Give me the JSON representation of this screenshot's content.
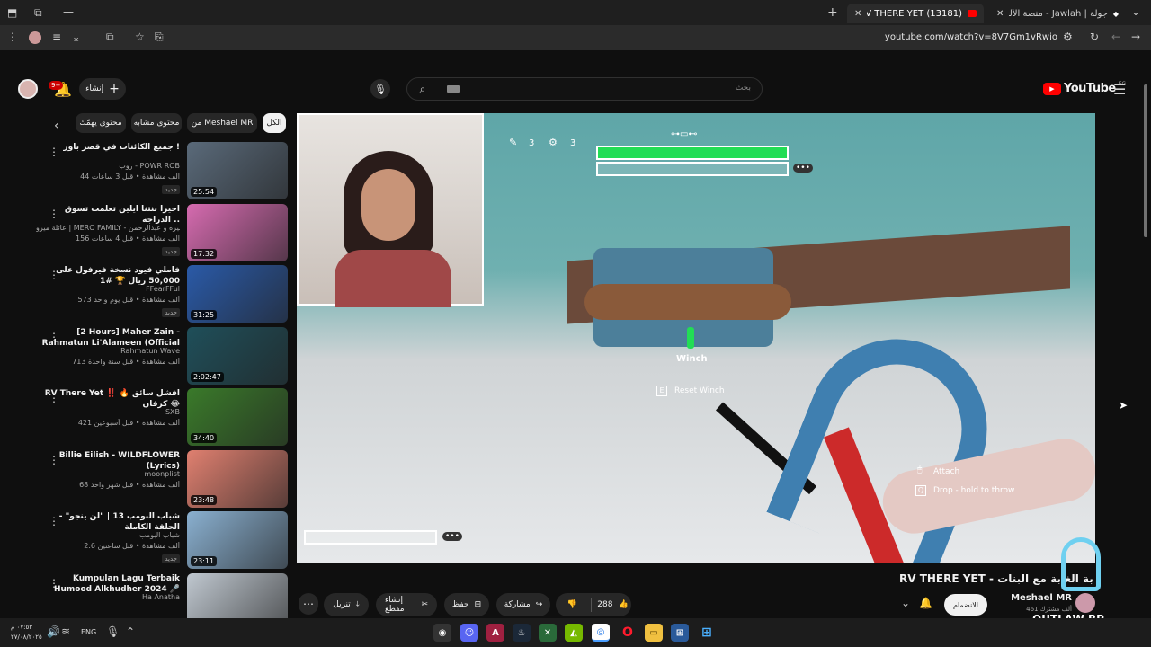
{
  "browser": {
    "tabs": [
      {
        "title": "جولة | Jawlah - منصة الألعاب الـ",
        "active": false
      },
      {
        "title": "(13181) RV THERE YET - البنـات",
        "active": true
      }
    ],
    "new_tab": "+",
    "url": "youtube.com/watch?v=8V7Gm1vRwio"
  },
  "youtube": {
    "logo": "YouTube",
    "country": "EG",
    "search_placeholder": "بحث",
    "create_label": "إنشاء",
    "notif_count": "9+",
    "chips": [
      "الكل",
      "من Meshael MR",
      "محتوى مشابه",
      "محتوى يهمّك"
    ],
    "recommendations": [
      {
        "title": "جميع الكائنات في قصر باور !",
        "channel": "روب - POWR ROB",
        "meta": "44 ألف مشاهدة • قبل 3 ساعات",
        "duration": "25:54",
        "badge": "جديد",
        "thumb": "#5a6a7a"
      },
      {
        "title": "اخيرا بنتنا ايلين تعلمت تسوق الدراجه ..",
        "channel": "عائلة ميرو | MERO FAMILY - اميره و عبدالرحمن",
        "meta": "156 ألف مشاهدة • قبل 4 ساعات",
        "duration": "17:32",
        "badge": "جديد",
        "thumb": "#d66bb0"
      },
      {
        "title": "فاملي فيود نسخة فيرفول على 50,000 ريال 🏆 #1",
        "channel": "FFearFFul",
        "meta": "573 ألف مشاهدة • قبل يوم واحد",
        "duration": "31:25",
        "badge": "جديد",
        "thumb": "#2a5aa8"
      },
      {
        "title": "[2 Hours] Maher Zain - Rahmatun Li'Alameen (Official",
        "channel": "Rahmatun Wave",
        "meta": "713 ألف مشاهدة • قبل سنة واحدة",
        "duration": "2:02:47",
        "badge": "",
        "thumb": "#1f4f5a"
      },
      {
        "title": "RV There Yet ‼️ 🔥 افشل سائق كرفان 😂",
        "channel": "SXB",
        "meta": "421 ألف مشاهدة • قبل أسبوعين",
        "duration": "34:40",
        "badge": "",
        "thumb": "#3a7a2a"
      },
      {
        "title": "Billie Eilish - WILDFLOWER (Lyrics)",
        "channel": "moonplist",
        "meta": "68 ألف مشاهدة • قبل شهر واحد",
        "duration": "23:48",
        "badge": "",
        "thumb": "#e08070"
      },
      {
        "title": "شباب البومب 13 | \"لن ينجو\" - الحلقة الكاملة",
        "channel": "شباب البومب",
        "meta": "2.6 ألف مشاهدة • قبل ساعتين",
        "duration": "23:11",
        "badge": "جديد",
        "thumb": "#8ab0d0"
      },
      {
        "title": "Kumpulan Lagu Terbaik Humood Alkhudher 2024 🎤",
        "channel": "Ha Anatha",
        "meta": "",
        "duration": "",
        "badge": "",
        "thumb": "#c0c8d0"
      }
    ],
    "video": {
      "title": "RV THERE YET - تجربة الغابة مع البنات",
      "channel": "Meshael MR",
      "subscribers": "461 ألف مشترك",
      "join_label": "الانضمام",
      "likes": "288",
      "share_label": "مشاركة",
      "save_label": "حفظ",
      "clip_label": "إنشاء مقطع",
      "download_label": "تنزيل",
      "hud": {
        "pencil_count": "3",
        "tool_count": "3",
        "winch_label": "Winch",
        "reset_label": "Reset Winch",
        "reset_key": "E",
        "attach_label": "Attach",
        "drop_label": "Drop - hold to throw",
        "drop_key": "Q"
      }
    }
  },
  "taskbar": {
    "lang": "ENG",
    "time": "٠٧:٥٣ م",
    "date": "٢٧/٠٨/٢٠٢٥",
    "watermark": "OUTLAW RP"
  },
  "colors": {
    "accent_red": "#ff0000",
    "health_green": "#22dd55",
    "page_bg": "#0f0f0f"
  }
}
